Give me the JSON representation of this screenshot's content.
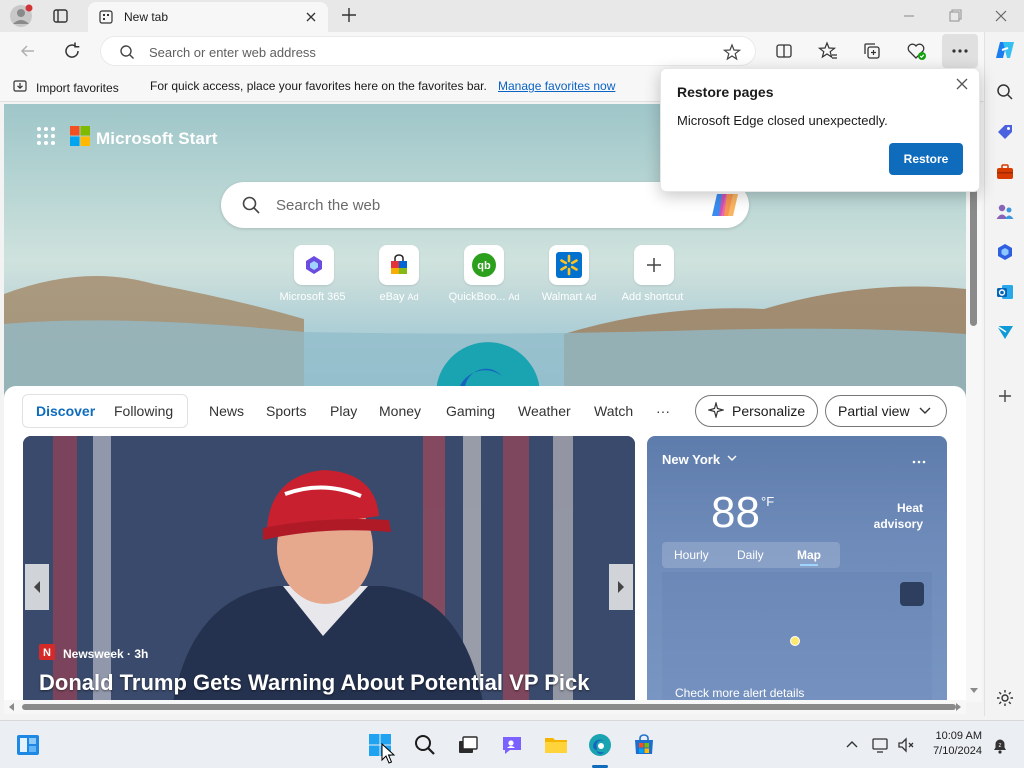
{
  "window": {
    "tab_title": "New tab"
  },
  "toolbar": {
    "address_placeholder": "Search or enter web address"
  },
  "favorites_bar": {
    "import_label": "Import favorites",
    "message": "For quick access, place your favorites here on the favorites bar.",
    "manage_link": "Manage favorites now"
  },
  "restore_popup": {
    "title": "Restore pages",
    "message": "Microsoft Edge closed unexpectedly.",
    "button": "Restore"
  },
  "newtab": {
    "brand": "Microsoft Start",
    "search_placeholder": "Search the web",
    "shortcuts": [
      {
        "name": "Microsoft 365",
        "ad": ""
      },
      {
        "name": "eBay",
        "ad": "Ad"
      },
      {
        "name": "QuickBoo...",
        "ad": "Ad"
      },
      {
        "name": "Walmart",
        "ad": "Ad"
      },
      {
        "name": "Add shortcut",
        "ad": ""
      }
    ]
  },
  "feed": {
    "tabs": [
      "Discover",
      "Following",
      "News",
      "Sports",
      "Play",
      "Money",
      "Gaming",
      "Weather",
      "Watch",
      "···"
    ],
    "active_tab": "Discover",
    "personalize": "Personalize",
    "view": "Partial view"
  },
  "news": {
    "source": "Newsweek · 3h",
    "headline": "Donald Trump Gets Warning About Potential VP Pick"
  },
  "weather": {
    "city": "New York",
    "temp": "88",
    "unit": "°F",
    "alert_line1": "Heat",
    "alert_line2": "advisory",
    "tabs": [
      "Hourly",
      "Daily",
      "Map"
    ],
    "active_tab": "Map",
    "alert_link": "Check more alert details"
  },
  "taskbar": {
    "time": "10:09 AM",
    "date": "7/10/2024"
  },
  "colors": {
    "accent": "#0f6cbd",
    "link": "#0b63c4"
  }
}
